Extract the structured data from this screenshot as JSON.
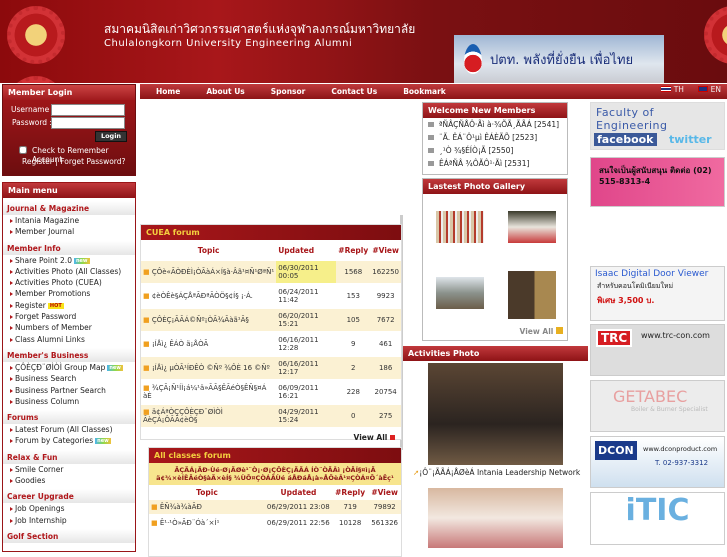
{
  "header": {
    "title_th": "สมาคมนิสิตเก่าวิศวกรรมศาสตร์แห่งจุฬาลงกรณ์มหาวิทยาลัย",
    "title_en": "Chulalongkorn University Engineering Alumni",
    "banner_text": "ปตท. พลังที่ยั่งยืน เพื่อไทย"
  },
  "nav": {
    "items": [
      "Home",
      "About Us",
      "Sponsor",
      "Contact Us",
      "Bookmark"
    ],
    "lang_th": "TH",
    "lang_en": "EN"
  },
  "login": {
    "title": "Member Login",
    "username_label": "Username :",
    "password_label": "Password :",
    "username": "",
    "password": "",
    "login_button": "Login",
    "remember": "Check to Remember Account",
    "register": "Register",
    "separator": "|",
    "forgot": "Forget Password?"
  },
  "menu": {
    "title": "Main menu",
    "sections": [
      {
        "title": "Journal & Magazine",
        "items": [
          {
            "label": "Intania Magazine"
          },
          {
            "label": "Member Journal"
          }
        ]
      },
      {
        "title": "Member Info",
        "items": [
          {
            "label": "Share Point 2.0",
            "badge": "new"
          },
          {
            "label": "Activities Photo (All Classes)"
          },
          {
            "label": "Activities Photo (CUEA)"
          },
          {
            "label": "Member Promotions"
          },
          {
            "label": "Register",
            "badge": "HOT"
          },
          {
            "label": "Forget Password"
          },
          {
            "label": "Numbers of Member"
          },
          {
            "label": "Class Alumni Links"
          }
        ]
      },
      {
        "title": "Member's Business",
        "items": [
          {
            "label": "ÇÔÈÇÐ¨ØÌÒÌ Group Map",
            "badge": "new"
          },
          {
            "label": "Business Search"
          },
          {
            "label": "Business Partner Search"
          },
          {
            "label": "Business Column"
          }
        ]
      },
      {
        "title": "Forums",
        "items": [
          {
            "label": "Latest Forum (All Classes)"
          },
          {
            "label": "Forum by Categories",
            "badge": "new"
          }
        ]
      },
      {
        "title": "Relax & Fun",
        "items": [
          {
            "label": "Smile Corner"
          },
          {
            "label": "Goodies"
          }
        ]
      },
      {
        "title": "Career Upgrade",
        "items": [
          {
            "label": "Job Openings"
          },
          {
            "label": "Job Internship"
          }
        ]
      },
      {
        "title": "Golf Section",
        "items": []
      }
    ]
  },
  "cuea_forum": {
    "title": "CUEA forum",
    "columns": [
      "Topic",
      "Updated",
      "#Reply",
      "#View"
    ],
    "rows": [
      {
        "topic": "ÇÔè«ÃÒÐÈÌ¡ÒÃàÁ×Í§à·Âã¹¤Ñ¹ØªÑ¹",
        "updated": "06/30/2011 00:05",
        "reply": "1568",
        "view": "162250"
      },
      {
        "topic": "¢èÒÊè§ÁÇÅªÃÐªÃÒÖ§¢Í§ ¡·Á.",
        "updated": "06/24/2011 11:42",
        "reply": "153",
        "view": "9923"
      },
      {
        "topic": "ÇÔÈÇ¡ÃÃÁ©Ñº¡ÒÃ¾Ãàã¹Ã§",
        "updated": "06/20/2011 15:21",
        "reply": "105",
        "view": "7672"
      },
      {
        "topic": "¡ÍÅì¿ ÊÁÒ ä¡ÅÒÃ",
        "updated": "06/16/2011 12:28",
        "reply": "9",
        "view": "461"
      },
      {
        "topic": "¡ÍÅì¿ µÒÃ¹ÍÐÊÒ ©Ñº ¾ÔÈ 16 ©Ñº",
        "updated": "06/16/2011 12:17",
        "reply": "2",
        "view": "186"
      },
      {
        "topic": "¾ÇÃ¡Ñ¹ÍÌ¡á¼¹ä»ÃÃ§ÊÃéÒ§ÊÑ§¤Á àÈ",
        "updated": "06/09/2011 16:21",
        "reply": "228",
        "view": "20754"
      },
      {
        "topic": "ä¢ÁªÒÇÇÔÈÇÐ¨ØÌÒÌ ÃèÇÁ¡ÔÃÃ¢èÒ§",
        "updated": "04/29/2011 15:24",
        "reply": "0",
        "view": "275"
      }
    ],
    "view_all": "View All"
  },
  "all_classes_forum": {
    "title": "All classes forum",
    "notice": "ÃÇÃÁ¡ÃÐ·Ùé·Ø¡ÃØè¹¨Ò¡·Ø¡ÇÔÈÇ¡ÃÃÁ ÍÒ¨ÒÃÂì ¡ÒÃÍ§¤ì¡Ã ä¢¾×èÍÊÃéÒ§àÃ×èÍ§ ¾ÙÔ¤ÇÒÁÃÙé áÅÐáÅ¡à»ÅÕèÂ¹¤ÇÒÁ¤Ô´àËç¹",
    "columns": [
      "Topic",
      "Updated",
      "#Reply",
      "#View"
    ],
    "rows": [
      {
        "topic": "ÊÑ¾à¾àÃÐ",
        "updated": "06/29/2011 23:08",
        "reply": "719",
        "view": "79892"
      },
      {
        "topic": "Ê¹·¹Ò»ÃÐ¨Óà´×Í¹",
        "updated": "06/29/2011 22:56",
        "reply": "10128",
        "view": "561326"
      }
    ]
  },
  "welcome": {
    "title": "Welcome New Members",
    "members": [
      "ªÑÂÇÑÅÔ·Ãì à·¾ÕÃ¸ÃÃÁ [2541]",
      "¨Ã. ÊÁ¨Ô¹µì ÊÁÈÃÕ [2523]",
      "¸¹Ò ¾§ÉÍÒ¡Ã [2550]",
      "ÊÁªÑÂ ¾ÔÃÔ¹·Ãì [2531]"
    ]
  },
  "gallery": {
    "title": "Lastest Photo Gallery",
    "view_all": "View All"
  },
  "activities": {
    "title": "Activities Photo",
    "caption": "¡Ô¨¡ÃÃÁ¡ÅØèÁ Intania Leadership Network"
  },
  "ads": [
    "Faculty of Engineering",
    "facebook",
    "twitter",
    "สนใจเป็นผู้สนับสนุน ติดต่อ (02) 515-8313-4",
    "Isaac Digital Door Viewer",
    "สำหรับคอนโดมิเนียมใหม่",
    "พิเศษ 3,500 บ.",
    "TRC",
    "www.trc-con.com",
    "GETABEC",
    "Boiler & Burner Specialist",
    "DCON",
    "www.dconproduct.com",
    "T. 02-937-3312",
    "iTIC"
  ]
}
